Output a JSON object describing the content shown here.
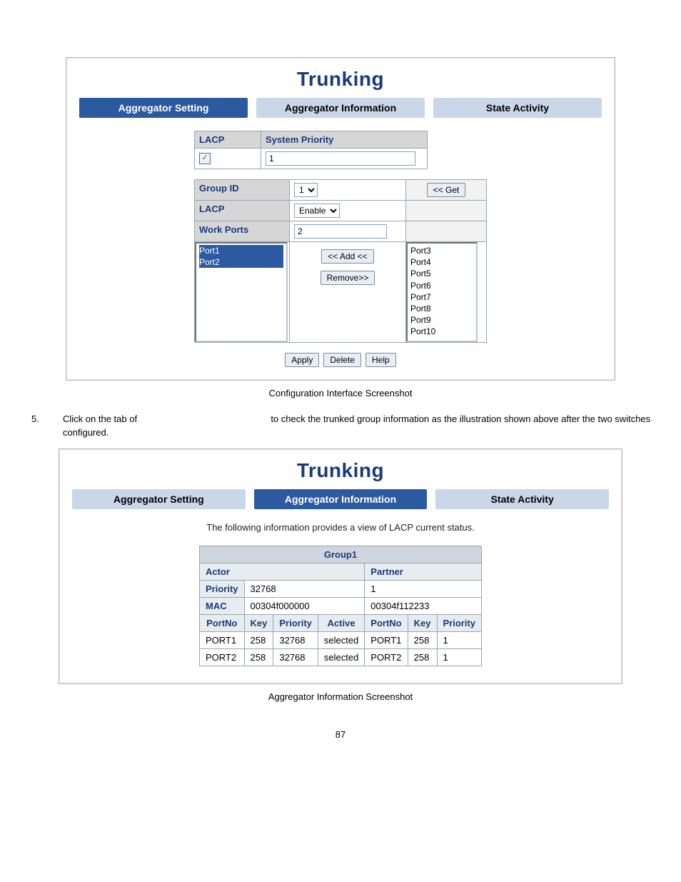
{
  "page_number": "87",
  "caption1": "Configuration Interface Screenshot",
  "caption2": "Aggregator Information Screenshot",
  "paragraph": {
    "num": "5.",
    "before_gap": "Click on the tab of",
    "after_gap": "to check the trunked group information as the illustration shown above after the two switches configured."
  },
  "shot1": {
    "title": "Trunking",
    "tabs": [
      "Aggregator Setting",
      "Aggregator Information",
      "State Activity"
    ],
    "active_tab": 0,
    "top_labels": {
      "lacp": "LACP",
      "sys_priority": "System Priority"
    },
    "top_values": {
      "lacp_checked": true,
      "sys_priority": "1"
    },
    "labels": {
      "group_id": "Group ID",
      "lacp": "LACP",
      "work_ports": "Work Ports"
    },
    "group_id_value": "1",
    "lacp_select_value": "Enable",
    "work_ports_value": "2",
    "get_btn": "<< Get",
    "add_btn": "<< Add <<",
    "remove_btn": "Remove>>",
    "left_ports": [
      "Port1",
      "Port2"
    ],
    "right_ports": [
      "Port3",
      "Port4",
      "Port5",
      "Port6",
      "Port7",
      "Port8",
      "Port9",
      "Port10"
    ],
    "footer_buttons": [
      "Apply",
      "Delete",
      "Help"
    ]
  },
  "shot2": {
    "title": "Trunking",
    "tabs": [
      "Aggregator Setting",
      "Aggregator Information",
      "State Activity"
    ],
    "active_tab": 1,
    "note": "The following information provides a view of LACP current status.",
    "group_header": "Group1",
    "actor": "Actor",
    "partner": "Partner",
    "rows": {
      "priority_label": "Priority",
      "mac_label": "MAC",
      "actor_priority": "32768",
      "partner_priority": "1",
      "actor_mac": "00304f000000",
      "partner_mac": "00304f112233"
    },
    "col_headers_actor": [
      "PortNo",
      "Key",
      "Priority",
      "Active"
    ],
    "col_headers_partner": [
      "PortNo",
      "Key",
      "Priority"
    ],
    "data": [
      {
        "a_port": "PORT1",
        "a_key": "258",
        "a_pri": "32768",
        "a_active": "selected",
        "p_port": "PORT1",
        "p_key": "258",
        "p_pri": "1"
      },
      {
        "a_port": "PORT2",
        "a_key": "258",
        "a_pri": "32768",
        "a_active": "selected",
        "p_port": "PORT2",
        "p_key": "258",
        "p_pri": "1"
      }
    ]
  }
}
